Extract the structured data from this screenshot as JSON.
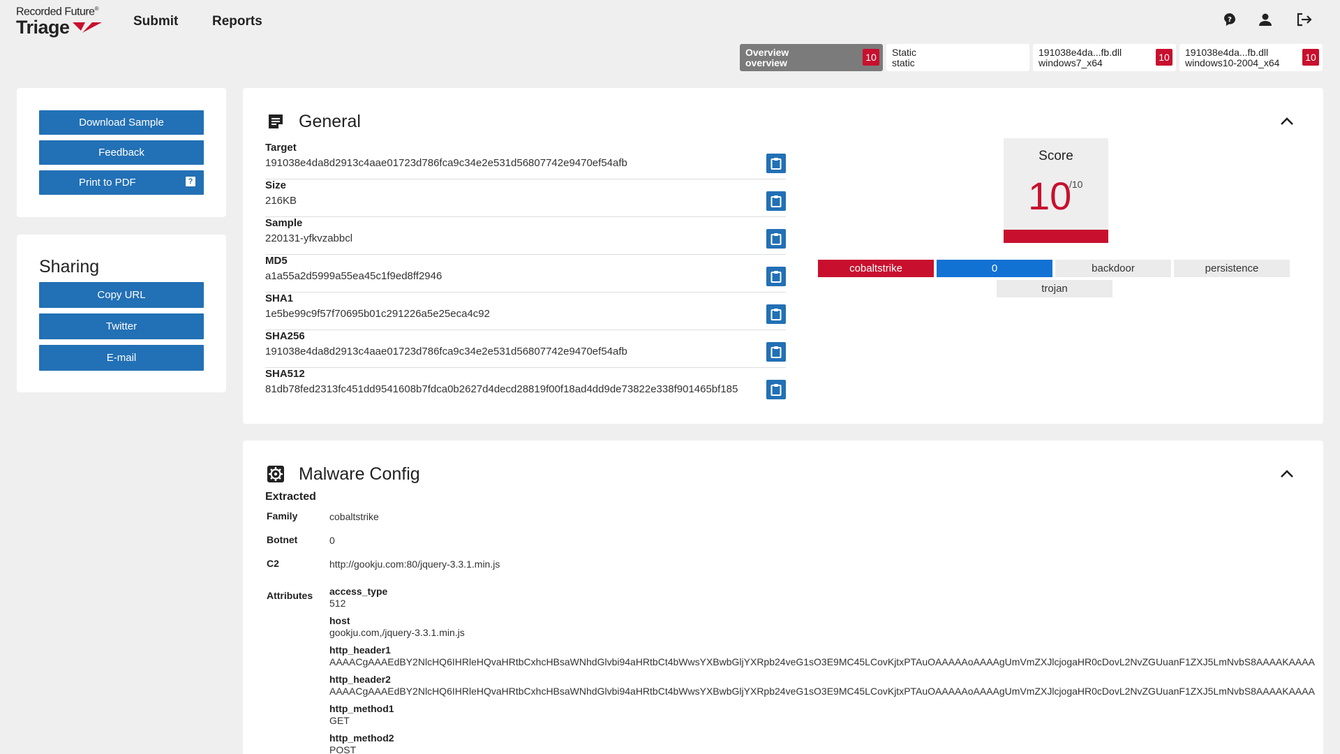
{
  "header": {
    "logo_top": "Recorded Future",
    "logo_reg": "®",
    "logo_bottom": "Triage",
    "nav": [
      {
        "label": "Submit"
      },
      {
        "label": "Reports"
      }
    ],
    "icons": [
      "help-icon",
      "account-icon",
      "logout-icon"
    ]
  },
  "tabs": [
    {
      "line1": "Overview",
      "line2": "overview",
      "badge": "10"
    },
    {
      "line1": "Static",
      "line2": "static",
      "badge": ""
    },
    {
      "line1": "191038e4da...fb.dll",
      "line2": "windows7_x64",
      "badge": "10"
    },
    {
      "line1": "191038e4da...fb.dll",
      "line2": "windows10-2004_x64",
      "badge": "10"
    }
  ],
  "actions": {
    "download": "Download Sample",
    "feedback": "Feedback",
    "print": "Print to PDF",
    "print_help": "?"
  },
  "sharing": {
    "title": "Sharing",
    "copy_url": "Copy URL",
    "twitter": "Twitter",
    "email": "E-mail"
  },
  "general": {
    "title": "General",
    "fields": [
      {
        "label": "Target",
        "value": "191038e4da8d2913c4aae01723d786fca9c34e2e531d56807742e9470ef54afb"
      },
      {
        "label": "Size",
        "value": "216KB"
      },
      {
        "label": "Sample",
        "value": "220131-yfkvzabbcl"
      },
      {
        "label": "MD5",
        "value": "a1a55a2d5999a55ea45c1f9ed8ff2946"
      },
      {
        "label": "SHA1",
        "value": "1e5be99c9f57f70695b01c291226a5e25eca4c92"
      },
      {
        "label": "SHA256",
        "value": "191038e4da8d2913c4aae01723d786fca9c34e2e531d56807742e9470ef54afb"
      },
      {
        "label": "SHA512",
        "value": "81db78fed2313fc451dd9541608b7fdca0b2627d4decd28819f00f18ad4dd9de73822e338f901465bf185"
      }
    ],
    "score": {
      "title": "Score",
      "value": "10",
      "max": "/10"
    },
    "tags": [
      "cobaltstrike",
      "0",
      "backdoor",
      "persistence",
      "trojan"
    ]
  },
  "config": {
    "title": "Malware Config",
    "subtitle": "Extracted",
    "rows": [
      {
        "label": "Family",
        "value": "cobaltstrike"
      },
      {
        "label": "Botnet",
        "value": "0"
      },
      {
        "label": "C2",
        "value": "http://gookju.com:80/jquery-3.3.1.min.js"
      }
    ],
    "attributes_label": "Attributes",
    "attributes": [
      {
        "key": "access_type",
        "value": "512"
      },
      {
        "key": "host",
        "value": "gookju.com,/jquery-3.3.1.min.js"
      },
      {
        "key": "http_header1",
        "value": "AAAACgAAAEdBY2NlcHQ6IHRleHQvaHRtbCxhcHBsaWNhdGlvbi94aHRtbCt4bWwsYXBwbGljYXRpb24veG1sO3E9MC45LCovKjtxPTAuOAAAAAoAAAAgUmVmZXJlcjogaHR0cDovL2NvZGUuanF1ZXJ5LmNvbS8AAAAKAAAA"
      },
      {
        "key": "http_header2",
        "value": "AAAACgAAAEdBY2NlcHQ6IHRleHQvaHRtbCxhcHBsaWNhdGlvbi94aHRtbCt4bWwsYXBwbGljYXRpb24veG1sO3E9MC45LCovKjtxPTAuOAAAAAoAAAAgUmVmZXJlcjogaHR0cDovL2NvZGUuanF1ZXJ5LmNvbS8AAAAKAAAA"
      },
      {
        "key": "http_method1",
        "value": "GET"
      },
      {
        "key": "http_method2",
        "value": "POST"
      }
    ]
  }
}
